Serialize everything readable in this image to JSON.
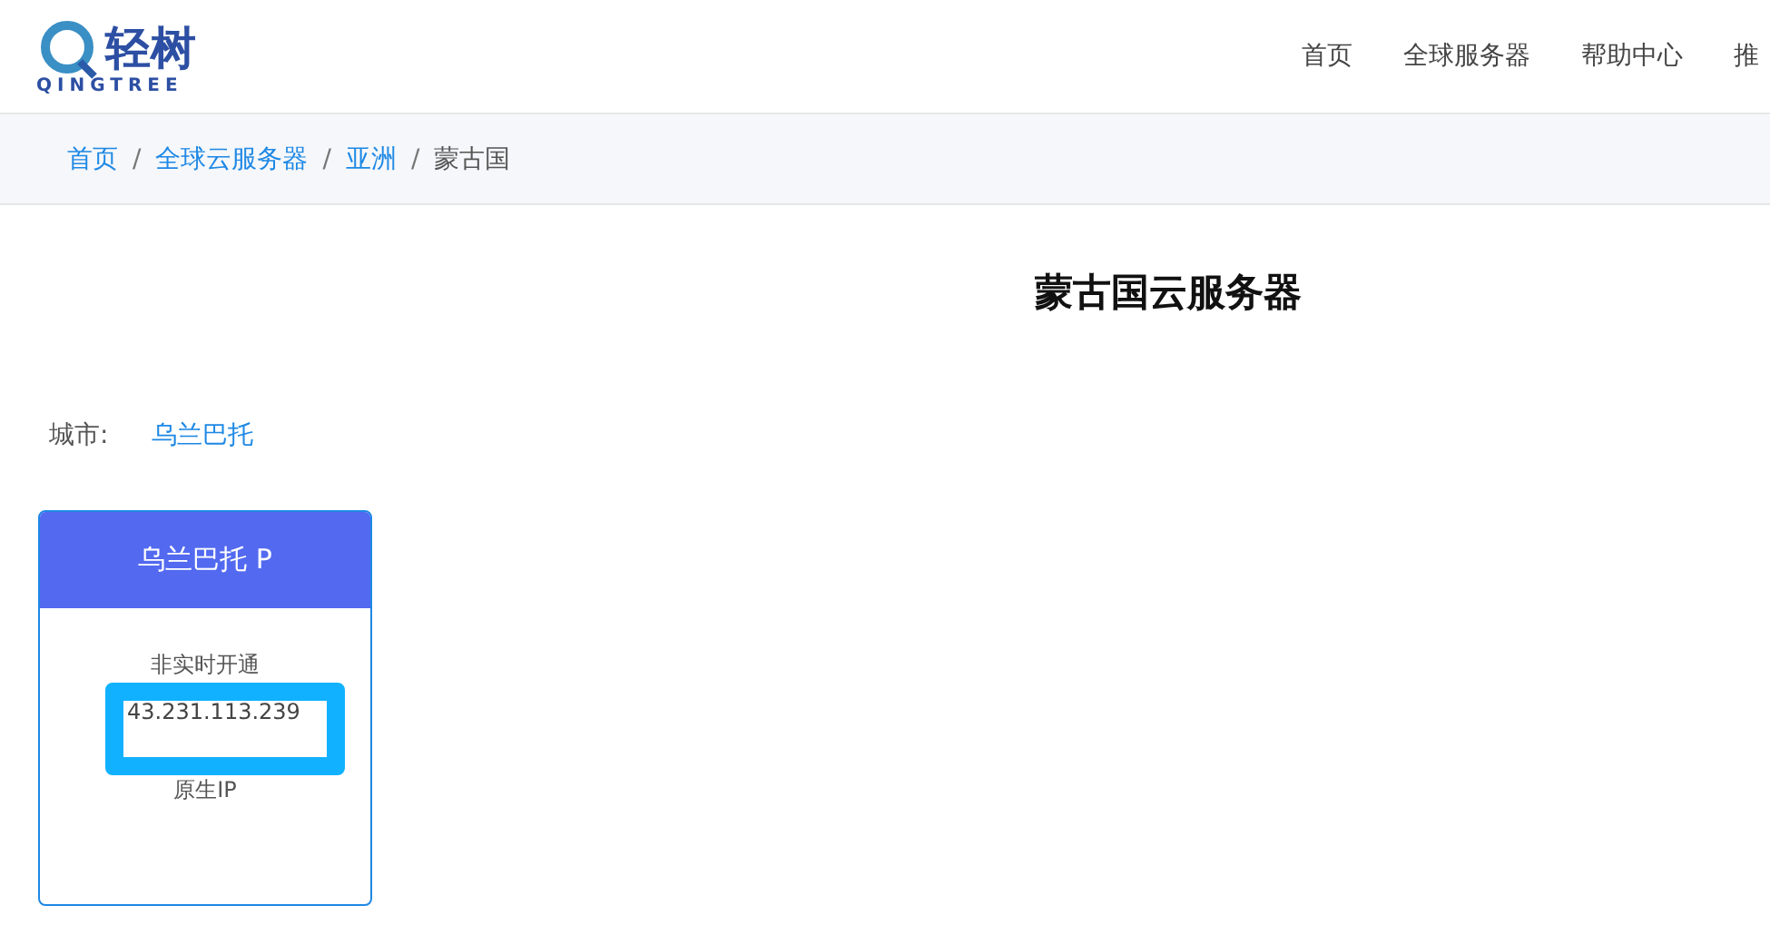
{
  "logo": {
    "name": "轻树",
    "subtitle": "QINGTREE"
  },
  "nav": [
    {
      "label": "首页"
    },
    {
      "label": "全球服务器"
    },
    {
      "label": "帮助中心"
    },
    {
      "label": "推"
    }
  ],
  "breadcrumb_separator": "/",
  "breadcrumb": [
    {
      "label": "首页",
      "link": true
    },
    {
      "label": "全球云服务器",
      "link": true
    },
    {
      "label": "亚洲",
      "link": true
    },
    {
      "label": "蒙古国",
      "link": false
    }
  ],
  "title": "蒙古国云服务器",
  "city": {
    "label": "城市:",
    "options": [
      {
        "label": "乌兰巴托"
      }
    ]
  },
  "cards": [
    {
      "title": "乌兰巴托 P",
      "features": [
        "非实时开通",
        "原生IP"
      ],
      "highlight": "43.231.113.239"
    }
  ]
}
